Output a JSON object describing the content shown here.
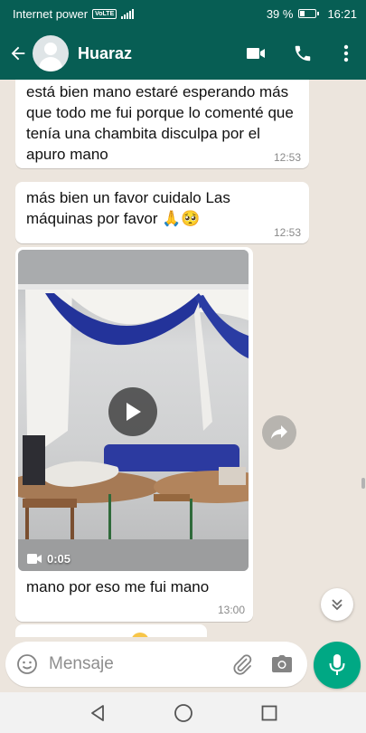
{
  "status_bar": {
    "carrier": "Internet power",
    "network_badge": "VoLTE",
    "battery": "39 %",
    "time": "16:21"
  },
  "header": {
    "contact_name": "Huaraz",
    "icons": [
      "back-arrow-icon",
      "default-avatar-icon",
      "video-call-icon",
      "phone-call-icon",
      "more-options-icon"
    ]
  },
  "messages": [
    {
      "type": "text",
      "text": "está bien mano estaré esperando más que todo me fui porque lo comenté que tenía una chambita disculpa por el apuro mano",
      "time": "12:53"
    },
    {
      "type": "text",
      "text": "más bien un favor cuidalo Las máquinas por favor",
      "emojis": "🙏🥺",
      "time": "12:53"
    },
    {
      "type": "video",
      "duration": "0:05",
      "caption": "mano por eso me fui mano",
      "time": "13:00"
    }
  ],
  "composer": {
    "placeholder": "Mensaje",
    "icons": [
      "emoji-icon",
      "attach-icon",
      "camera-icon",
      "mic-icon"
    ]
  },
  "colors": {
    "header": "#075e54",
    "chat_bg": "#ece5dd",
    "bubble_in": "#ffffff",
    "mic_button": "#00a884"
  }
}
